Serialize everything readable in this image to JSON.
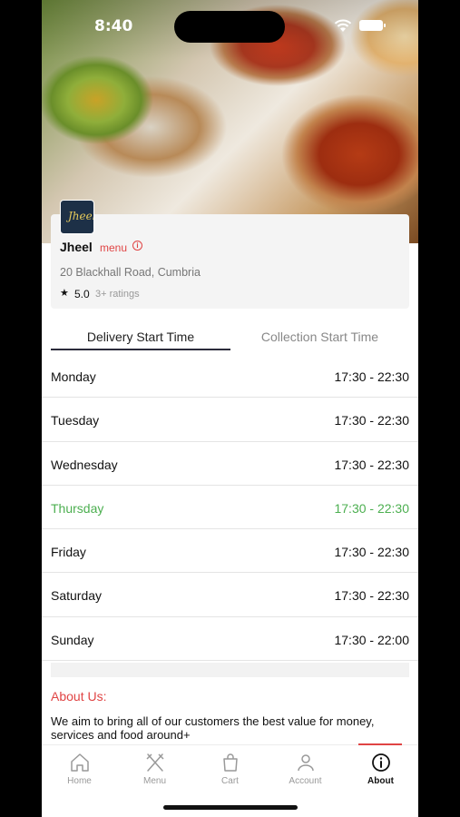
{
  "status_bar": {
    "time": "8:40"
  },
  "restaurant": {
    "logo_text": "Jheel",
    "name": "Jheel",
    "menu_link": "menu",
    "address": "20 Blackhall Road, Cumbria",
    "rating": "5.0",
    "rating_count": "3+ ratings"
  },
  "tabs": [
    {
      "label": "Delivery Start Time",
      "active": true
    },
    {
      "label": "Collection Start Time",
      "active": false
    }
  ],
  "schedule": [
    {
      "day": "Monday",
      "hours": "17:30 - 22:30"
    },
    {
      "day": "Tuesday",
      "hours": "17:30 - 22:30"
    },
    {
      "day": "Wednesday",
      "hours": "17:30 - 22:30"
    },
    {
      "day": "Thursday",
      "hours": "17:30 - 22:30"
    },
    {
      "day": "Friday",
      "hours": "17:30 - 22:30"
    },
    {
      "day": "Saturday",
      "hours": "17:30 - 22:30"
    },
    {
      "day": "Sunday",
      "hours": "17:30 - 22:00"
    }
  ],
  "about": {
    "title": "About Us:",
    "text": "We aim to bring all of our customers the best value for money, services and food around+"
  },
  "nav": [
    {
      "label": "Home",
      "icon": "home-icon"
    },
    {
      "label": "Menu",
      "icon": "fork-knife-icon"
    },
    {
      "label": "Cart",
      "icon": "bag-icon"
    },
    {
      "label": "Account",
      "icon": "person-icon"
    },
    {
      "label": "About",
      "icon": "info-icon"
    }
  ],
  "colors": {
    "accent": "#e04444",
    "today_highlight": "#4caf50",
    "tab_underline": "#2b2b3b"
  }
}
